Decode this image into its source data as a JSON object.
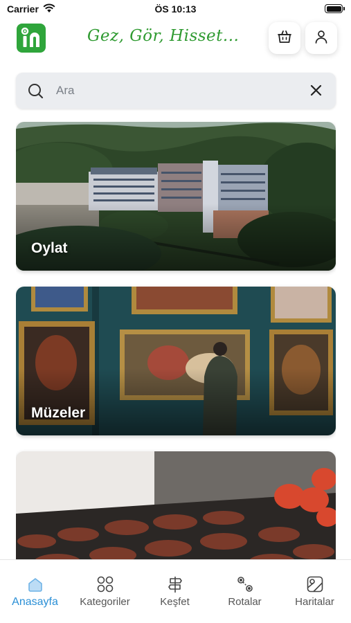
{
  "status_bar": {
    "carrier": "Carrier",
    "time": "ÖS 10:13"
  },
  "header": {
    "slogan": "Gez, Gör, Hisset..."
  },
  "search": {
    "placeholder": "Ara",
    "value": ""
  },
  "cards": [
    {
      "label": "Oylat"
    },
    {
      "label": "Müzeler"
    },
    {
      "label": ""
    }
  ],
  "tabs": [
    {
      "label": "Anasayfa",
      "icon": "home-icon",
      "active": true
    },
    {
      "label": "Kategoriler",
      "icon": "grid-icon",
      "active": false
    },
    {
      "label": "Keşfet",
      "icon": "signpost-icon",
      "active": false
    },
    {
      "label": "Rotalar",
      "icon": "route-icon",
      "active": false
    },
    {
      "label": "Haritalar",
      "icon": "map-icon",
      "active": false
    }
  ],
  "colors": {
    "brand_green": "#2fa53b",
    "active_tab": "#2a8fd6",
    "search_bg": "#ebedf0"
  }
}
